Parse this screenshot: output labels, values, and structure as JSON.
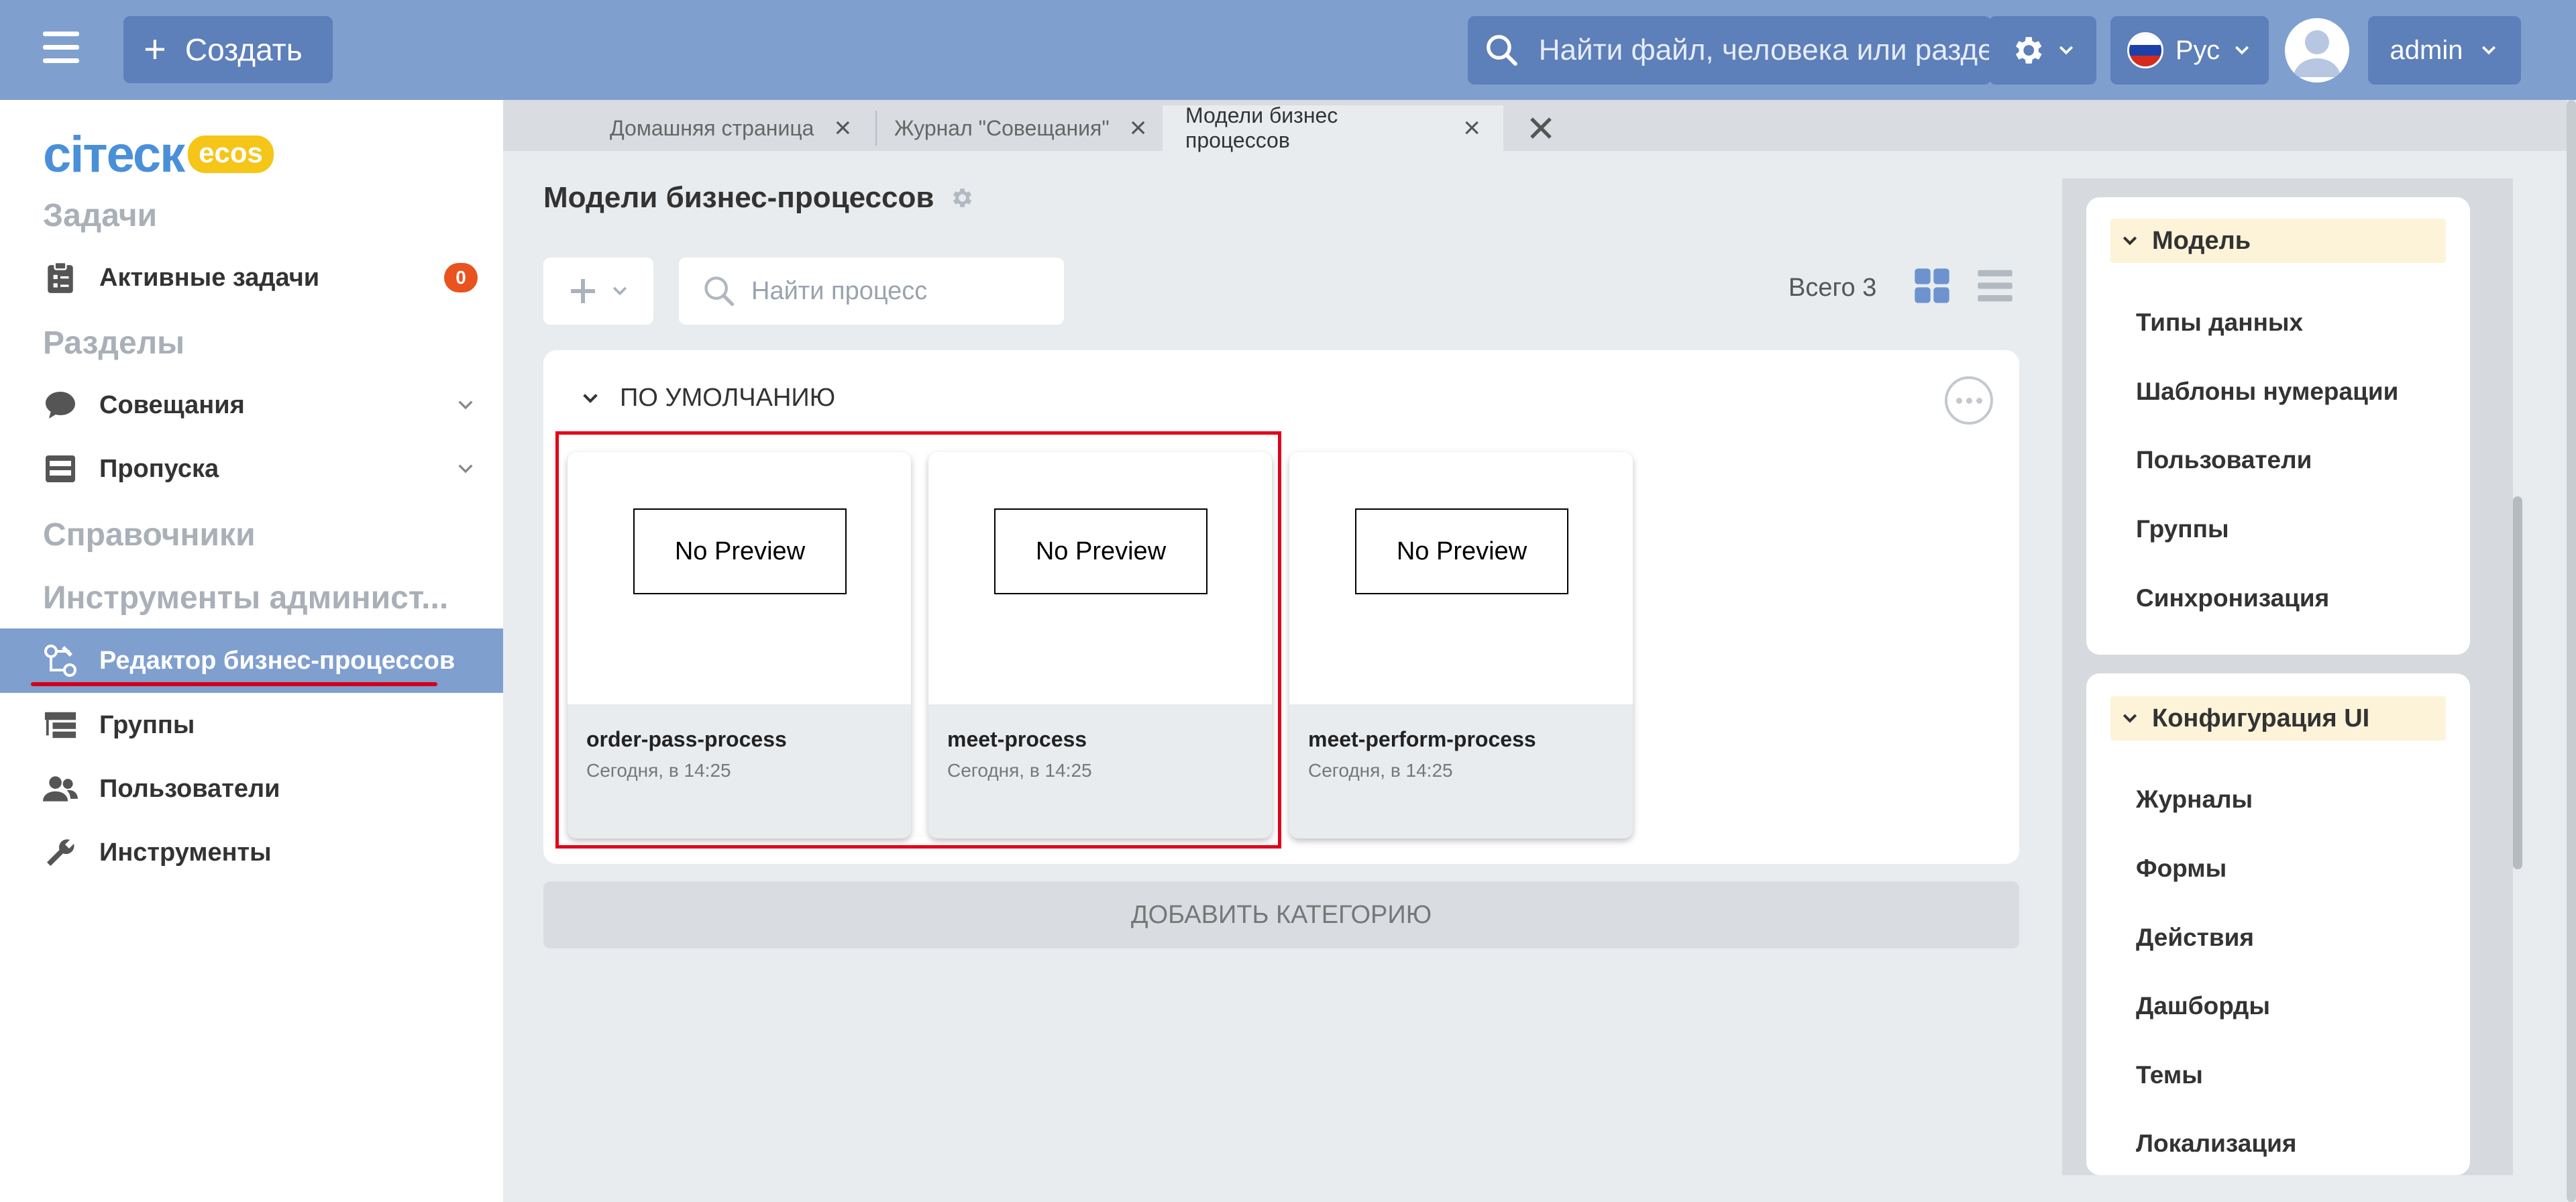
{
  "header": {
    "create_label": "Создать",
    "search_placeholder": "Найти файл, человека или раздел",
    "language": "Рус",
    "user": "admin"
  },
  "sidebar": {
    "logo_text": "ciтеск",
    "logo_badge": "ecos",
    "sections": {
      "tasks": "Задачи",
      "sections": "Разделы",
      "references": "Справочники",
      "admin_tools": "Инструменты админист..."
    },
    "items": [
      {
        "label": "Активные задачи",
        "badge": "0"
      },
      {
        "label": "Совещания"
      },
      {
        "label": "Пропуска"
      },
      {
        "label": "Редактор бизнес-процессов"
      },
      {
        "label": "Группы"
      },
      {
        "label": "Пользователи"
      },
      {
        "label": "Инструменты"
      }
    ]
  },
  "tabs": [
    {
      "label": "Домашняя страница"
    },
    {
      "label": "Журнал \"Совещания\""
    },
    {
      "label": "Модели бизнес процессов"
    }
  ],
  "main": {
    "title": "Модели бизнес-процессов",
    "search_placeholder": "Найти процесс",
    "total": "Всего 3",
    "category_title": "ПО УМОЛЧАНИЮ",
    "add_category": "ДОБАВИТЬ КАТЕГОРИЮ",
    "cards": [
      {
        "preview": "No Preview",
        "name": "order-pass-process",
        "date": "Сегодня, в 14:25"
      },
      {
        "preview": "No Preview",
        "name": "meet-process",
        "date": "Сегодня, в 14:25"
      },
      {
        "preview": "No Preview",
        "name": "meet-perform-process",
        "date": "Сегодня, в 14:25"
      }
    ]
  },
  "right_panel": {
    "model": {
      "title": "Модель",
      "items": [
        "Типы данных",
        "Шаблоны нумерации",
        "Пользователи",
        "Группы",
        "Синхронизация"
      ]
    },
    "ui_config": {
      "title": "Конфигурация UI",
      "items": [
        "Журналы",
        "Формы",
        "Действия",
        "Дашборды",
        "Темы",
        "Локализация"
      ]
    }
  },
  "colors": {
    "header": "#7f9fcf",
    "header_button": "#5d7fba",
    "active_item": "#7f9fcf",
    "badge": "#e8531f",
    "highlight": "#e2001a"
  }
}
